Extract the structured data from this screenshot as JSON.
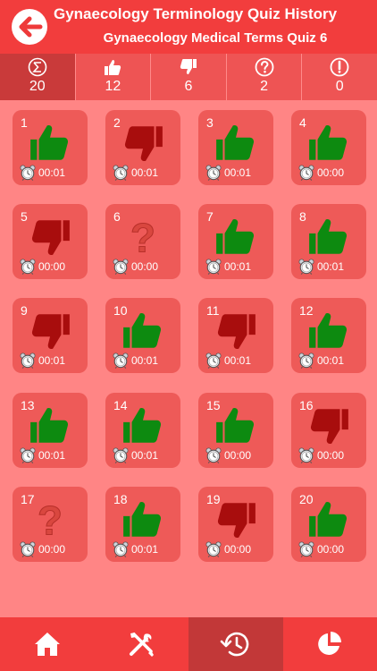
{
  "header": {
    "title": "Gynaecology Terminology Quiz History",
    "subtitle": "Gynaecology Medical Terms Quiz 6",
    "back_icon": "back-arrow-icon"
  },
  "stats": [
    {
      "icon": "sum-icon",
      "value": "20"
    },
    {
      "icon": "thumb-up-icon",
      "value": "12"
    },
    {
      "icon": "thumb-down-icon",
      "value": "6"
    },
    {
      "icon": "question-icon",
      "value": "2"
    },
    {
      "icon": "exclamation-icon",
      "value": "0"
    }
  ],
  "questions": [
    {
      "number": "1",
      "result": "correct",
      "time": "00:01"
    },
    {
      "number": "2",
      "result": "wrong",
      "time": "00:01"
    },
    {
      "number": "3",
      "result": "correct",
      "time": "00:01"
    },
    {
      "number": "4",
      "result": "correct",
      "time": "00:00"
    },
    {
      "number": "5",
      "result": "wrong",
      "time": "00:00"
    },
    {
      "number": "6",
      "result": "unanswered",
      "time": "00:00"
    },
    {
      "number": "7",
      "result": "correct",
      "time": "00:01"
    },
    {
      "number": "8",
      "result": "correct",
      "time": "00:01"
    },
    {
      "number": "9",
      "result": "wrong",
      "time": "00:01"
    },
    {
      "number": "10",
      "result": "correct",
      "time": "00:01"
    },
    {
      "number": "11",
      "result": "wrong",
      "time": "00:01"
    },
    {
      "number": "12",
      "result": "correct",
      "time": "00:01"
    },
    {
      "number": "13",
      "result": "correct",
      "time": "00:01"
    },
    {
      "number": "14",
      "result": "correct",
      "time": "00:01"
    },
    {
      "number": "15",
      "result": "correct",
      "time": "00:00"
    },
    {
      "number": "16",
      "result": "wrong",
      "time": "00:00"
    },
    {
      "number": "17",
      "result": "unanswered",
      "time": "00:00"
    },
    {
      "number": "18",
      "result": "correct",
      "time": "00:01"
    },
    {
      "number": "19",
      "result": "wrong",
      "time": "00:00"
    },
    {
      "number": "20",
      "result": "correct",
      "time": "00:00"
    }
  ],
  "tabs": [
    {
      "icon": "home-icon",
      "active": false
    },
    {
      "icon": "tools-icon",
      "active": false
    },
    {
      "icon": "history-icon",
      "active": true
    },
    {
      "icon": "pie-chart-icon",
      "active": false
    }
  ],
  "colors": {
    "background": "#ff8585",
    "bar": "#f23d3d",
    "tile": "#ee5a58",
    "correct": "#0d8a10",
    "wrong": "#a80d0d",
    "unanswered": "#d9473f"
  }
}
